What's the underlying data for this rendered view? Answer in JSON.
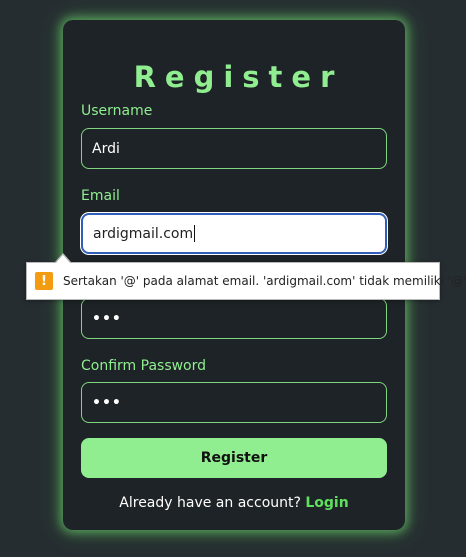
{
  "form": {
    "title": "Register",
    "username_label": "Username",
    "username_value": "Ardi",
    "email_label": "Email",
    "email_value": "ardigmail.com",
    "password_value": "•••",
    "confirm_password_label": "Confirm Password",
    "confirm_password_value": "•••",
    "submit_label": "Register",
    "footer_text": "Already have an account?",
    "login_link": "Login"
  },
  "validation_tooltip": {
    "icon": "warning-icon",
    "icon_glyph": "!",
    "message": "Sertakan '@' pada alamat email. 'ardigmail.com' tidak memiliki '@'."
  },
  "colors": {
    "background": "#262d31",
    "card": "#1d2326",
    "accent": "#90ee90",
    "link": "#5ee05e",
    "warning": "#f39c12",
    "focus_border": "#2f5fb8"
  }
}
